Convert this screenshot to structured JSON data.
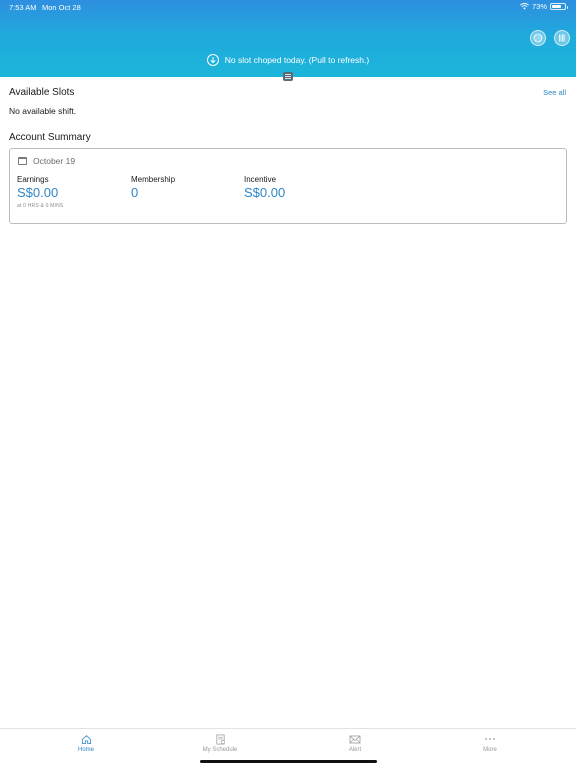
{
  "status_bar": {
    "time": "7:53 AM",
    "date": "Mon Oct 28",
    "battery": "73%",
    "battery_level": 0.73
  },
  "header": {
    "pull_message": "No slot choped today. (Pull to refresh.)"
  },
  "available_slots": {
    "title": "Available Slots",
    "see_all": "See all",
    "empty_message": "No available shift."
  },
  "account_summary": {
    "title": "Account Summary",
    "date": "October 19",
    "earnings": {
      "label": "Earnings",
      "value": "S$0.00",
      "sub": "at 0 HRS & 0 MINS"
    },
    "membership": {
      "label": "Membership",
      "value": "0"
    },
    "incentive": {
      "label": "Incentive",
      "value": "S$0.00"
    }
  },
  "tabs": [
    {
      "label": "Home",
      "icon": "home-icon",
      "active": true
    },
    {
      "label": "My Schedule",
      "icon": "schedule-icon",
      "active": false
    },
    {
      "label": "Alert",
      "icon": "mail-icon",
      "active": false
    },
    {
      "label": "More",
      "icon": "more-icon",
      "active": false
    }
  ],
  "colors": {
    "accent": "#2e86c8",
    "header_gradient_top": "#2e8fe0",
    "header_gradient_bottom": "#1cb6da",
    "tab_inactive": "#9a9a9a"
  }
}
